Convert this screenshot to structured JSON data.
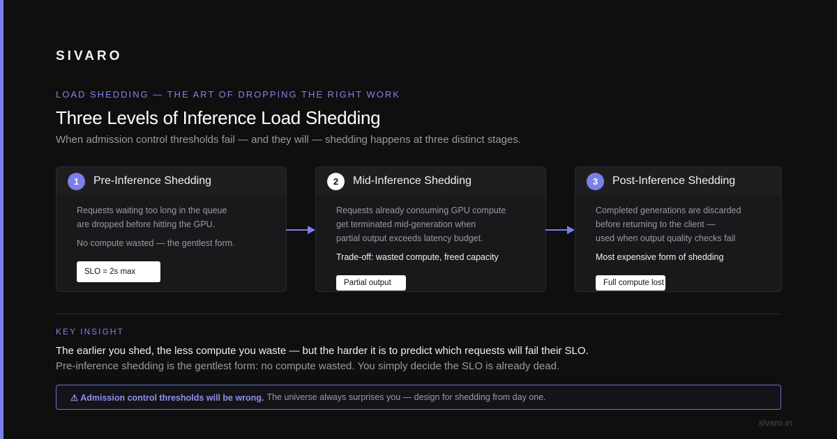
{
  "brand": "SIVARO",
  "eyebrow": "LOAD SHEDDING — THE ART OF DROPPING THE RIGHT WORK",
  "title": "Three Levels of Inference Load Shedding",
  "subtitle": "When admission control thresholds fail — and they will — shedding happens at three distinct stages.",
  "cards": [
    {
      "number": "1",
      "title": "Pre-Inference Shedding",
      "description": "Requests waiting too long in the queue\nare dropped before hitting the GPU.",
      "note": "No compute wasted — the gentlest form.",
      "pill": "SLO = 2s max"
    },
    {
      "number": "2",
      "title": "Mid-Inference Shedding",
      "description": "Requests already consuming GPU compute\nget terminated mid-generation when\npartial output exceeds latency budget.",
      "note": "Trade-off: wasted compute, freed capacity",
      "pill": "Partial output"
    },
    {
      "number": "3",
      "title": "Post-Inference Shedding",
      "description": "Completed generations are discarded\nbefore returning to the client —\nused when output quality checks fail",
      "note": "Most expensive form of shedding",
      "pill": "Full compute lost"
    }
  ],
  "key_insight": {
    "label": "KEY INSIGHT",
    "line1": "The earlier you shed, the less compute you waste — but the harder it is to predict which requests will fail their SLO.",
    "line2": "Pre-inference shedding is the gentlest form: no compute wasted. You simply decide the SLO is already dead."
  },
  "callout": {
    "strong": "⚠ Admission control thresholds will be wrong.",
    "text": "The universe always surprises you — design for shedding from day one."
  },
  "footer": "sivaro.in",
  "colors": {
    "accent": "#7b7fe8",
    "background": "#0f0f10",
    "card": "#19191b"
  }
}
